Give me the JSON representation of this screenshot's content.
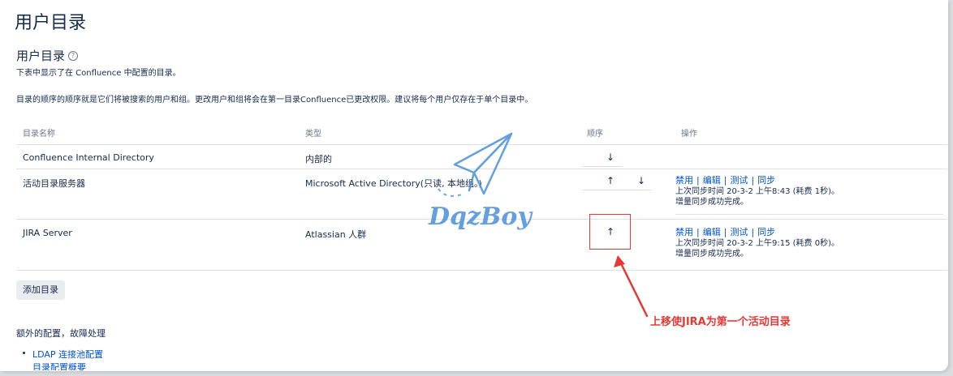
{
  "page": {
    "title": "用户目录"
  },
  "section": {
    "title": "用户目录",
    "description": "下表中显示了在 Confluence 中配置的目录。",
    "info": "目录的顺序的顺序就是它们将被搜索的用户和组。更改用户和组将会在第一目录Confluence已更改权限。建议将每个用户仅存在于单个目录中。"
  },
  "table": {
    "headers": {
      "name": "目录名称",
      "type": "类型",
      "order": "顺序",
      "actions": "操作"
    },
    "rows": [
      {
        "name": "Confluence Internal Directory",
        "type": "内部的",
        "order_arrows": [
          "↓"
        ]
      },
      {
        "name": "活动目录服务器",
        "type": "Microsoft Active Directory(只读, 本地组。)",
        "order_arrows": [
          "↑",
          "↓"
        ],
        "actions": {
          "links": [
            "禁用",
            "编辑",
            "测试",
            "同步"
          ],
          "line1": "上次同步时间 20-3-2 上午8:43 (耗费 1秒)。",
          "line2": "增量同步成功完成。"
        }
      },
      {
        "name": "JIRA Server",
        "type": "Atlassian 人群",
        "order_arrows": [
          "↑"
        ],
        "actions": {
          "links": [
            "禁用",
            "编辑",
            "测试",
            "同步"
          ],
          "line1": "上次同步时间 20-3-2 上午9:15 (耗费 0秒)。",
          "line2": "增量同步成功完成。"
        }
      }
    ]
  },
  "add_button": "添加目录",
  "extra": {
    "title": "额外的配置，故障处理",
    "links": [
      "LDAP 连接池配置",
      "目录配置概要"
    ]
  },
  "watermark": "DqzBoy",
  "annotation": "上移使JIRA为第一个活动目录",
  "colors": {
    "link": "#0052cc",
    "annotation": "#e53935",
    "watermark": "#4a90d9"
  }
}
